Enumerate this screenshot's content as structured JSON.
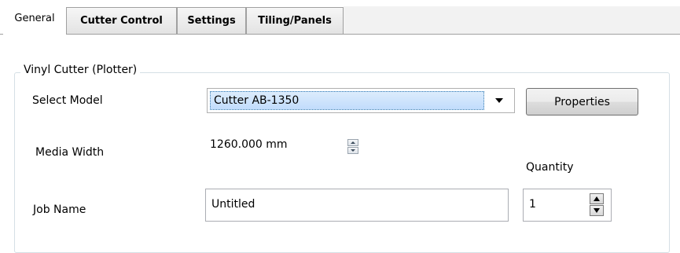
{
  "tabs": [
    {
      "label": "General",
      "active": true
    },
    {
      "label": "Cutter Control",
      "active": false
    },
    {
      "label": "Settings",
      "active": false
    },
    {
      "label": "Tiling/Panels",
      "active": false
    }
  ],
  "group": {
    "title": "Vinyl Cutter (Plotter)"
  },
  "model": {
    "label": "Select Model",
    "selected": "Cutter AB-1350"
  },
  "properties_button": {
    "label": "Properties"
  },
  "media_width": {
    "label": "Media Width",
    "value": "1260.000 mm"
  },
  "job_name": {
    "label": "Job Name",
    "value": "Untitled"
  },
  "quantity": {
    "label": "Quantity",
    "value": "1"
  },
  "icons": [
    "dropdown-arrow-icon",
    "spin-up-icon",
    "spin-down-icon"
  ]
}
